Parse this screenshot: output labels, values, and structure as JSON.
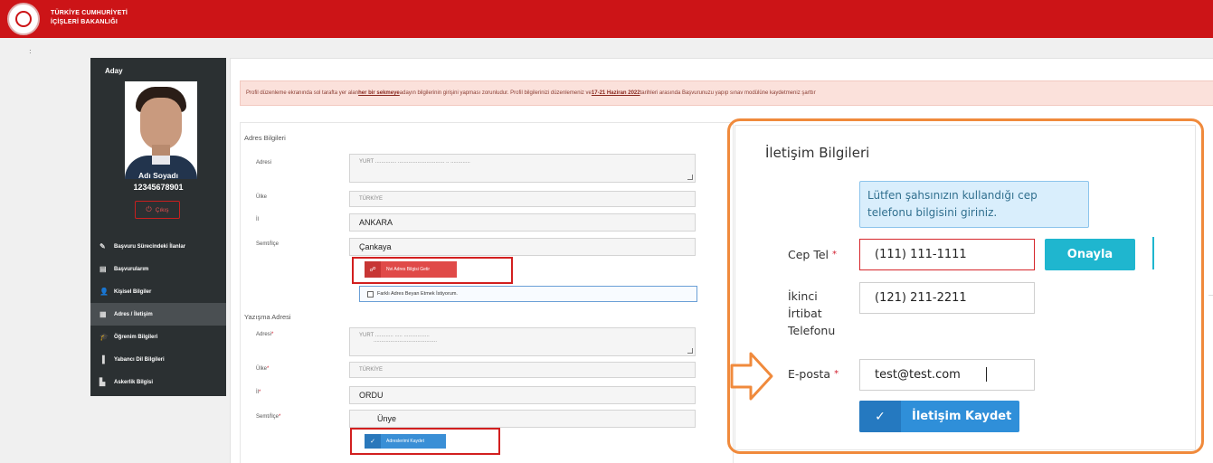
{
  "header": {
    "org_line1": "TÜRKİYE CUMHURİYETİ",
    "org_line2": "İÇİŞLERİ BAKANLIĞI"
  },
  "page_marker": ":",
  "sidebar": {
    "title": "Aday",
    "name": "Adı Soyadı",
    "id_number": "12345678901",
    "logout_label": "Çıkış",
    "items": [
      {
        "icon": "edit-icon",
        "glyph": "✎",
        "label": "Başvuru Sürecindeki İlanlar"
      },
      {
        "icon": "document-icon",
        "glyph": "▤",
        "label": "Başvurularım"
      },
      {
        "icon": "user-icon",
        "glyph": "👤",
        "label": "Kişisel Bilgiler"
      },
      {
        "icon": "address-card-icon",
        "glyph": "▦",
        "label": "Adres / İletişim"
      },
      {
        "icon": "graduation-icon",
        "glyph": "🎓",
        "label": "Öğrenim Bilgileri"
      },
      {
        "icon": "book-icon",
        "glyph": "▐",
        "label": "Yabancı Dil Bilgileri"
      },
      {
        "icon": "building-icon",
        "glyph": "▙",
        "label": "Askerlik Bilgisi"
      }
    ],
    "active_index": 3
  },
  "alert": {
    "text1": "Profil düzenleme ekranında sol tarafta yer alan ",
    "link1": "her bir sekmeye",
    "text2": " adayın bilgilerinin girişini yapması zorunludur.  Profil bilgilerinizi düzenlemeniz ve ",
    "link2": "17-21 Haziran 2022",
    "text3": " tarihleri arasında Başvurunuzu yapıp sınav modülüne kaydetmeniz şarttır"
  },
  "address": {
    "title": "Adres Bilgileri",
    "adres_label": "Adresi",
    "adres_value": "YURT ..............  ...............................  .. .............",
    "ulke_label": "Ülke",
    "ulke_value": "TÜRKİYE",
    "il_label": "İl",
    "il_value": "ANKARA",
    "semt_label": "Semt/İlçe",
    "semt_value": "Çankaya",
    "fetch_button": "Nvi Adres Bilgisi Getir",
    "checkbox_label": "Farklı Adres Beyan Etmek İstiyorum."
  },
  "mailing": {
    "title": "Yazışma Adresi",
    "adres_label": "Adresi",
    "adres_line1": "YURT ............ .....  .................",
    "adres_line2": "..........................................",
    "ulke_label": "Ülke",
    "ulke_value": "TÜRKİYE",
    "il_label": "İl",
    "il_value": "ORDU",
    "semt_label": "Semt/İlçe",
    "semt_value": "Ünye",
    "save_button": "Adreslerimi Kaydet",
    "required_mark": "*"
  },
  "contact": {
    "title": "İletişim Bilgileri",
    "info_text": "Lütfen şahsınızın kullandığı cep telefonu bilgisini giriniz.",
    "cep_label": "Cep Tel",
    "cep_value": "(111) 111-1111",
    "approve_button": "Onayla",
    "ikinci_label_1": "İkinci",
    "ikinci_label_2": "İrtibat",
    "ikinci_label_3": "Telefonu",
    "ikinci_value": "(121) 211-2211",
    "eposta_label": "E-posta",
    "eposta_value": "test@test.com",
    "save_button": "İletişim Kaydet",
    "required_mark": "*"
  },
  "colors": {
    "header_red": "#cc1417",
    "highlight_orange": "#f08a3c",
    "highlight_red": "#d21f1f",
    "primary_blue": "#2f8fd9",
    "info_cyan": "#1fb6cf"
  }
}
